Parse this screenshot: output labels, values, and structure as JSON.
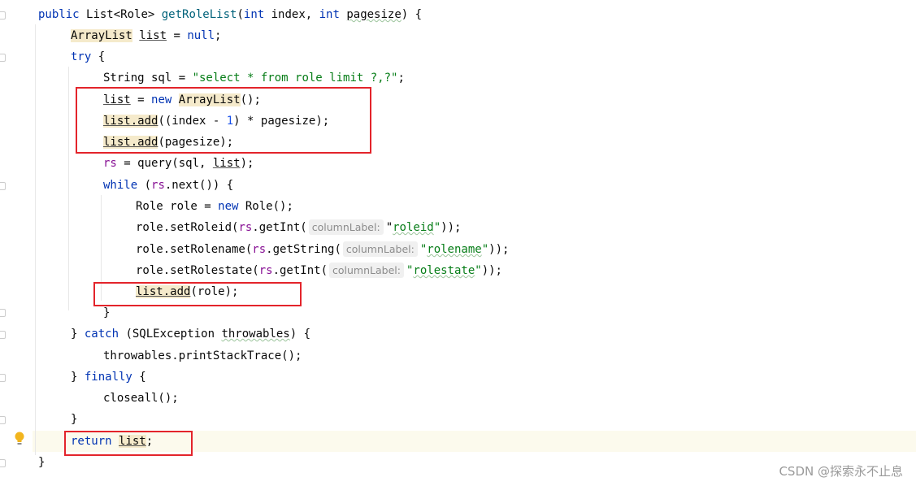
{
  "editor": {
    "lines": [
      {
        "indent": 0,
        "tokens": [
          {
            "t": "public ",
            "c": "kw"
          },
          {
            "t": "List<Role> "
          },
          {
            "t": "getRoleList",
            "c": "fn"
          },
          {
            "t": "("
          },
          {
            "t": "int ",
            "c": "kw"
          },
          {
            "t": "index, "
          },
          {
            "t": "int ",
            "c": "kw"
          },
          {
            "t": "pagesize",
            "c": "sq"
          },
          {
            "t": ") {"
          }
        ]
      },
      {
        "indent": 1,
        "tokens": [
          {
            "t": "ArrayList",
            "c": "hl"
          },
          {
            "t": " "
          },
          {
            "t": "list",
            "c": "u"
          },
          {
            "t": " = "
          },
          {
            "t": "null",
            "c": "kw"
          },
          {
            "t": ";"
          }
        ]
      },
      {
        "indent": 1,
        "tokens": [
          {
            "t": "try ",
            "c": "kw"
          },
          {
            "t": "{"
          }
        ]
      },
      {
        "indent": 2,
        "tokens": [
          {
            "t": "String sql = "
          },
          {
            "t": "\"select * from role limit ?,?\"",
            "c": "str"
          },
          {
            "t": ";"
          }
        ]
      },
      {
        "indent": 2,
        "tokens": [
          {
            "t": "list",
            "c": "u"
          },
          {
            "t": " = "
          },
          {
            "t": "new ",
            "c": "kw"
          },
          {
            "t": "ArrayList",
            "c": "hl"
          },
          {
            "t": "();"
          }
        ]
      },
      {
        "indent": 2,
        "tokens": [
          {
            "t": "list.add",
            "c": "hl u"
          },
          {
            "t": "((index - "
          },
          {
            "t": "1",
            "c": "num"
          },
          {
            "t": ") * pagesize);"
          }
        ]
      },
      {
        "indent": 2,
        "tokens": [
          {
            "t": "list.add",
            "c": "hl u"
          },
          {
            "t": "(pagesize);"
          }
        ]
      },
      {
        "indent": 2,
        "tokens": [
          {
            "t": "rs",
            "c": "fld"
          },
          {
            "t": " = query(sql, "
          },
          {
            "t": "list",
            "c": "u"
          },
          {
            "t": ");"
          }
        ]
      },
      {
        "indent": 2,
        "tokens": [
          {
            "t": "while ",
            "c": "kw"
          },
          {
            "t": "("
          },
          {
            "t": "rs",
            "c": "fld"
          },
          {
            "t": ".next()) {"
          }
        ]
      },
      {
        "indent": 3,
        "tokens": [
          {
            "t": "Role role = "
          },
          {
            "t": "new ",
            "c": "kw"
          },
          {
            "t": "Role();"
          }
        ]
      },
      {
        "indent": 3,
        "tokens": [
          {
            "t": "role.setRoleid("
          },
          {
            "t": "rs",
            "c": "fld"
          },
          {
            "t": ".getInt("
          },
          {
            "t": "columnLabel:",
            "c": "hint"
          },
          {
            "t": "\""
          },
          {
            "t": "roleid",
            "c": "str sq"
          },
          {
            "t": "\"",
            "c": "str"
          },
          {
            "t": "));"
          }
        ]
      },
      {
        "indent": 3,
        "tokens": [
          {
            "t": "role.setRolename("
          },
          {
            "t": "rs",
            "c": "fld"
          },
          {
            "t": ".getString("
          },
          {
            "t": "columnLabel:",
            "c": "hint"
          },
          {
            "t": "\"",
            "c": "str"
          },
          {
            "t": "rolename",
            "c": "str sq"
          },
          {
            "t": "\"",
            "c": "str"
          },
          {
            "t": "));"
          }
        ]
      },
      {
        "indent": 3,
        "tokens": [
          {
            "t": "role.setRolestate("
          },
          {
            "t": "rs",
            "c": "fld"
          },
          {
            "t": ".getInt("
          },
          {
            "t": "columnLabel:",
            "c": "hint"
          },
          {
            "t": "\"",
            "c": "str"
          },
          {
            "t": "rolestate",
            "c": "str sq"
          },
          {
            "t": "\"",
            "c": "str"
          },
          {
            "t": "));"
          }
        ]
      },
      {
        "indent": 3,
        "tokens": [
          {
            "t": "list.add",
            "c": "hl u"
          },
          {
            "t": "(role);"
          }
        ]
      },
      {
        "indent": 2,
        "tokens": [
          {
            "t": "}"
          }
        ]
      },
      {
        "indent": 1,
        "tokens": [
          {
            "t": "} "
          },
          {
            "t": "catch ",
            "c": "kw"
          },
          {
            "t": "(SQLException "
          },
          {
            "t": "throwables",
            "c": "sq"
          },
          {
            "t": ") {"
          }
        ]
      },
      {
        "indent": 2,
        "tokens": [
          {
            "t": "throwables.printStackTrace();"
          }
        ]
      },
      {
        "indent": 1,
        "tokens": [
          {
            "t": "} "
          },
          {
            "t": "finally ",
            "c": "kw"
          },
          {
            "t": "{"
          }
        ]
      },
      {
        "indent": 2,
        "tokens": [
          {
            "t": "closeall();"
          }
        ]
      },
      {
        "indent": 1,
        "tokens": [
          {
            "t": "}"
          }
        ]
      },
      {
        "indent": 1,
        "tokens": [
          {
            "t": "return ",
            "c": "kw"
          },
          {
            "t": "list",
            "c": "hl u"
          },
          {
            "t": ";"
          }
        ]
      },
      {
        "indent": 0,
        "tokens": [
          {
            "t": "}"
          }
        ]
      }
    ],
    "current_line_color": "#fcfaed",
    "annotation_color": "#e3242b",
    "gutter_icon": "lightbulb-icon"
  },
  "watermark": "CSDN @探索永不止息"
}
